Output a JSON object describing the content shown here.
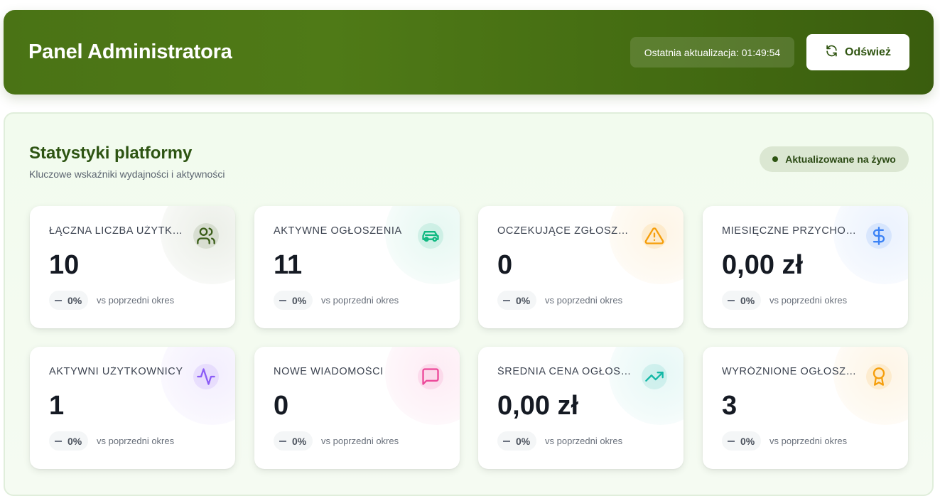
{
  "header": {
    "title": "Panel Administratora",
    "last_update": "Ostatnia aktualizacja: 01:49:54",
    "refresh_label": "Odśwież"
  },
  "stats": {
    "title": "Statystyki platformy",
    "subtitle": "Kluczowe wskaźniki wydajności i aktywności",
    "live_label": "Aktualizowane na żywo",
    "cards": [
      {
        "label": "ŁĄCZNA LICZBA UŻYTKOWNIKÓW",
        "value": "10",
        "change": "0%",
        "period": "vs poprzedni okres",
        "icon": "users-icon",
        "color": "#3a5d18"
      },
      {
        "label": "AKTYWNE OGŁOSZENIA",
        "value": "11",
        "change": "0%",
        "period": "vs poprzedni okres",
        "icon": "car-icon",
        "color": "#10b981"
      },
      {
        "label": "OCZEKUJĄCE ZGŁOSZENIA",
        "value": "0",
        "change": "0%",
        "period": "vs poprzedni okres",
        "icon": "alert-triangle-icon",
        "color": "#f59e0b"
      },
      {
        "label": "MIESIĘCZNE PRZYCHODY",
        "value": "0,00 zł",
        "change": "0%",
        "period": "vs poprzedni okres",
        "icon": "dollar-icon",
        "color": "#3b82f6"
      },
      {
        "label": "AKTYWNI UŻYTKOWNICY",
        "value": "1",
        "change": "0%",
        "period": "vs poprzedni okres",
        "icon": "activity-icon",
        "color": "#8b5cf6"
      },
      {
        "label": "NOWE WIADOMOŚCI",
        "value": "0",
        "change": "0%",
        "period": "vs poprzedni okres",
        "icon": "message-icon",
        "color": "#ec4899"
      },
      {
        "label": "ŚREDNIA CENA OGŁOSZENIA",
        "value": "0,00 zł",
        "change": "0%",
        "period": "vs poprzedni okres",
        "icon": "trending-up-icon",
        "color": "#14b8a6"
      },
      {
        "label": "WYRÓŻNIONE OGŁOSZENIA",
        "value": "3",
        "change": "0%",
        "period": "vs poprzedni okres",
        "icon": "award-icon",
        "color": "#f59e0b"
      }
    ]
  }
}
